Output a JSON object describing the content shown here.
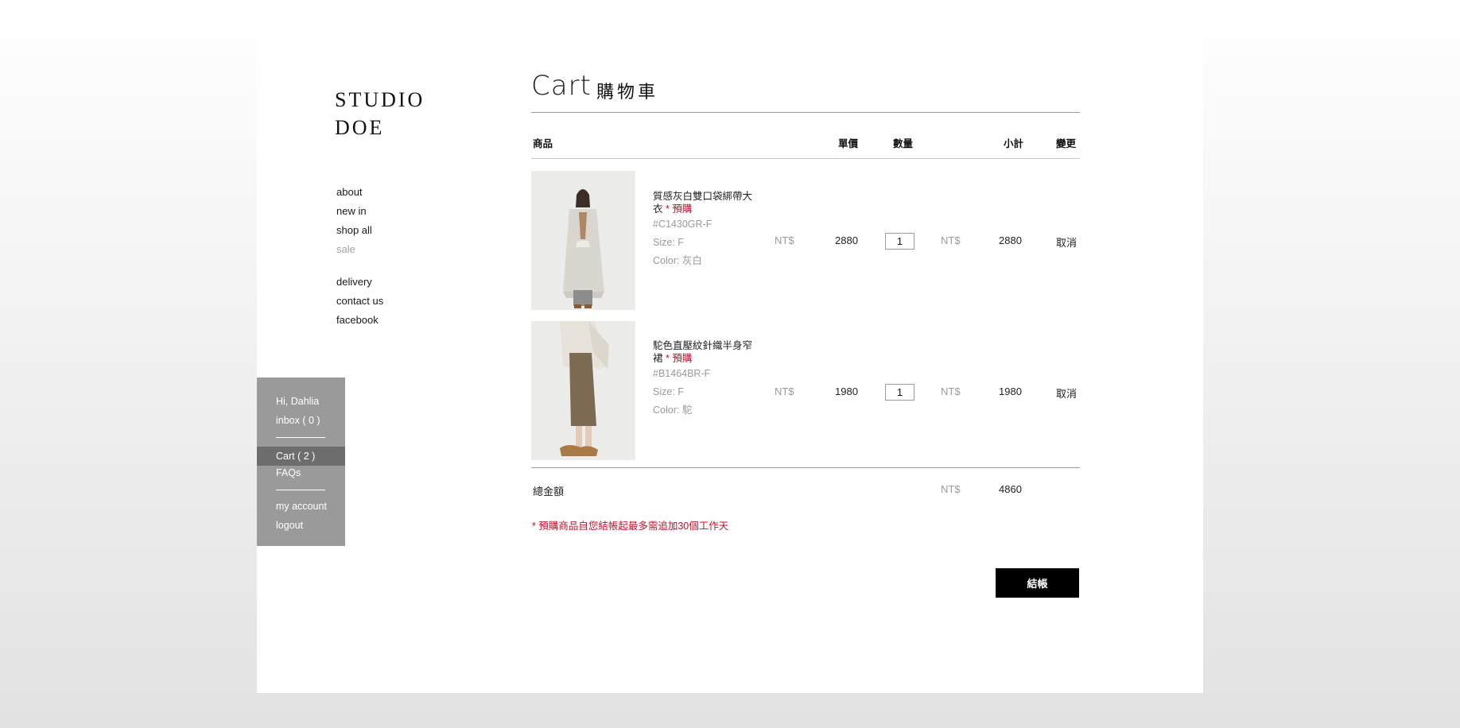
{
  "brand": {
    "line1": "STUDIO",
    "line2": "DOE"
  },
  "nav": {
    "main": [
      "about",
      "new in",
      "shop all",
      "sale"
    ],
    "info": [
      "delivery",
      "contact us",
      "facebook"
    ]
  },
  "account": {
    "greeting": "Hi, Dahlia",
    "inbox": "inbox ( 0 )",
    "cart": "Cart ( 2 )",
    "faqs": "FAQs",
    "my_account": "my account",
    "logout": "logout"
  },
  "cart": {
    "title_en": "Cart",
    "title_zh": "購物車",
    "headers": {
      "product": "商品",
      "unit_price": "單價",
      "quantity": "數量",
      "subtotal": "小計",
      "action": "變更"
    },
    "items": [
      {
        "name": "質感灰白雙口袋綁帶大衣",
        "preorder": "* 預購",
        "sku": "#C1430GR-F",
        "size": "Size: F",
        "color": "Color: 灰白",
        "currency": "NT$",
        "price": "2880",
        "qty": "1",
        "subtotal_currency": "NT$",
        "subtotal": "2880",
        "cancel": "取消",
        "image_icon": "coat-photo"
      },
      {
        "name": "駝色直壓紋針織半身窄裙",
        "preorder": "* 預購",
        "sku": "#B1464BR-F",
        "size": "Size: F",
        "color": "Color: 駝",
        "currency": "NT$",
        "price": "1980",
        "qty": "1",
        "subtotal_currency": "NT$",
        "subtotal": "1980",
        "cancel": "取消",
        "image_icon": "skirt-photo"
      }
    ],
    "total_label": "總金額",
    "total_currency": "NT$",
    "total": "4860",
    "note": "* 預購商品自您結帳起最多需追加30個工作天",
    "checkout": "結帳"
  },
  "colors": {
    "accent_red": "#c8102e",
    "sidebar_gray": "#9a9a9a",
    "active_gray": "#6d6d6d",
    "button_black": "#000000"
  }
}
